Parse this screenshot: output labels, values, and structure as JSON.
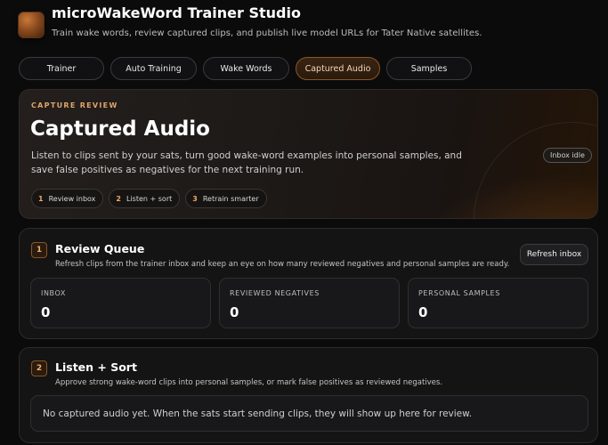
{
  "app": {
    "title": "microWakeWord Trainer Studio",
    "subtitle": "Train wake words, review captured clips, and publish live model URLs for Tater Native satellites.",
    "logo_icon": "app-logo-icon"
  },
  "tabs": [
    {
      "label": "Trainer",
      "active": false
    },
    {
      "label": "Auto Training",
      "active": false
    },
    {
      "label": "Wake Words",
      "active": false
    },
    {
      "label": "Captured Audio",
      "active": true
    },
    {
      "label": "Samples",
      "active": false
    }
  ],
  "hero": {
    "eyebrow": "CAPTURE REVIEW",
    "title": "Captured Audio",
    "description": "Listen to clips sent by your sats, turn good wake-word examples into personal samples, and save false positives as negatives for the next training run.",
    "status_badge": "Inbox idle",
    "steps": [
      {
        "num": "1",
        "label": "Review inbox"
      },
      {
        "num": "2",
        "label": "Listen + sort"
      },
      {
        "num": "3",
        "label": "Retrain smarter"
      }
    ]
  },
  "review_queue": {
    "num": "1",
    "title": "Review Queue",
    "description": "Refresh clips from the trainer inbox and keep an eye on how many reviewed negatives and personal samples are ready.",
    "refresh_label": "Refresh inbox",
    "stats": [
      {
        "label": "INBOX",
        "value": "0"
      },
      {
        "label": "REVIEWED NEGATIVES",
        "value": "0"
      },
      {
        "label": "PERSONAL SAMPLES",
        "value": "0"
      }
    ]
  },
  "listen_sort": {
    "num": "2",
    "title": "Listen + Sort",
    "description": "Approve strong wake-word clips into personal samples, or mark false positives as reviewed negatives.",
    "empty_message": "No captured audio yet. When the sats start sending clips, they will show up here for review."
  },
  "colors": {
    "accent": "#e0a46a",
    "background": "#0b0b0c",
    "card": "#141415"
  }
}
